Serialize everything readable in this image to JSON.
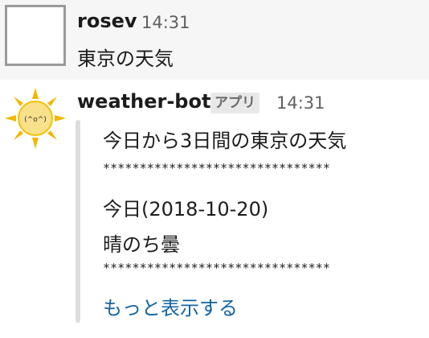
{
  "messages": [
    {
      "author": "rosev",
      "time": "14:31",
      "text": "東京の天気"
    },
    {
      "author": "weather-bot",
      "badge": "アプリ",
      "time": "14:31",
      "avatar_face": "(^o^)",
      "attachment": {
        "title": "今日から3日間の東京の天気",
        "separator": "*******************************",
        "date_line": "今日(2018-10-20)",
        "forecast": "晴のち曇",
        "separator2": "*******************************",
        "more_link": "もっと表示する"
      }
    }
  ],
  "colors": {
    "link": "#1264a3",
    "sun": "#f5c518",
    "sun_rays": "#f2b705",
    "badge_bg": "#e8e8e8",
    "attach_bar": "#dddddd"
  },
  "icons": {
    "user_avatar": "avatar-placeholder",
    "bot_avatar": "sun-face-icon"
  }
}
